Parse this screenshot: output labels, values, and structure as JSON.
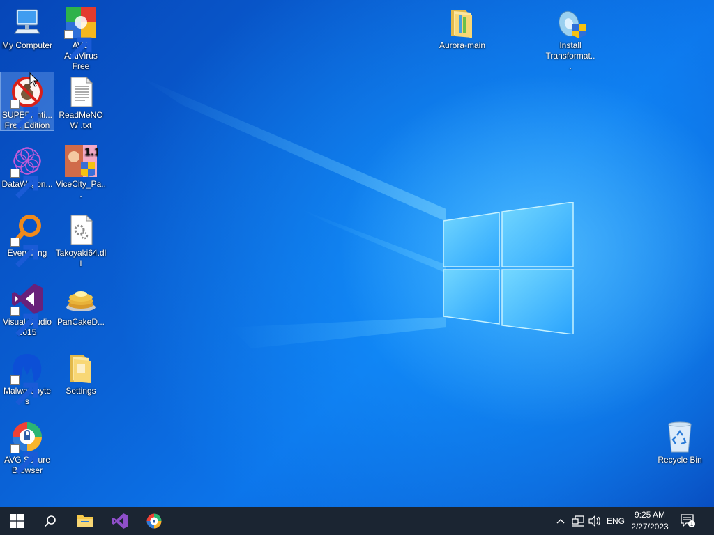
{
  "desktop_icons": [
    {
      "id": "my-computer",
      "label": "My Computer",
      "icon": "computer-icon"
    },
    {
      "id": "avg-antivirus",
      "label": "AVG AntiVirus Free",
      "icon": "avg-antivirus-icon",
      "shortcut": true
    },
    {
      "id": "superantispyware",
      "label": "SUPERAnti... Free Edition",
      "icon": "superantispyware-icon",
      "shortcut": true,
      "selected": true
    },
    {
      "id": "readmenow",
      "label": "ReadMeNOW .txt",
      "icon": "text-file-icon"
    },
    {
      "id": "datawagon",
      "label": "DataWagon...",
      "icon": "datawagon-icon",
      "shortcut": true
    },
    {
      "id": "vicecity",
      "label": "ViceCity_Pa...",
      "icon": "vicecity-installer-icon",
      "badge": "1.1"
    },
    {
      "id": "everything",
      "label": "Everything",
      "icon": "everything-search-icon",
      "shortcut": true
    },
    {
      "id": "takoyaki",
      "label": "Takoyaki64.dll",
      "icon": "dll-file-icon"
    },
    {
      "id": "visual-studio",
      "label": "Visual Studio 2015",
      "icon": "visual-studio-icon",
      "shortcut": true
    },
    {
      "id": "pancake",
      "label": "PanCakeD...",
      "icon": "pancake-icon"
    },
    {
      "id": "malwarebytes",
      "label": "Malwarebytes",
      "icon": "malwarebytes-icon",
      "shortcut": true
    },
    {
      "id": "settings",
      "label": "Settings",
      "icon": "folder-icon"
    },
    {
      "id": "avg-browser",
      "label": "AVG Secure Browser",
      "icon": "avg-secure-browser-icon",
      "shortcut": true
    },
    {
      "id": "aurora-main",
      "label": "Aurora-main",
      "icon": "folder-icon"
    },
    {
      "id": "install-transformat",
      "label": "Install Transformat...",
      "icon": "installer-icon"
    },
    {
      "id": "recycle-bin",
      "label": "Recycle Bin",
      "icon": "recycle-bin-icon"
    }
  ],
  "taskbar": {
    "start": "windows-start-icon",
    "search": "search-icon",
    "pinned": [
      {
        "id": "file-explorer",
        "icon": "file-explorer-icon"
      },
      {
        "id": "visual-studio",
        "icon": "visual-studio-icon"
      },
      {
        "id": "avg-secure-browser",
        "icon": "avg-secure-browser-icon"
      }
    ],
    "tray": {
      "chevron": "chevron-up-icon",
      "network": "network-icon",
      "volume": "volume-icon",
      "language": "ENG",
      "time": "9:25 AM",
      "date": "2/27/2023",
      "notifications": "notification-icon",
      "notification_count": "1"
    }
  },
  "colors": {
    "taskbar": "#1b2532",
    "desktop_accent": "#0a63d8",
    "selection": "#a0c8ff"
  }
}
